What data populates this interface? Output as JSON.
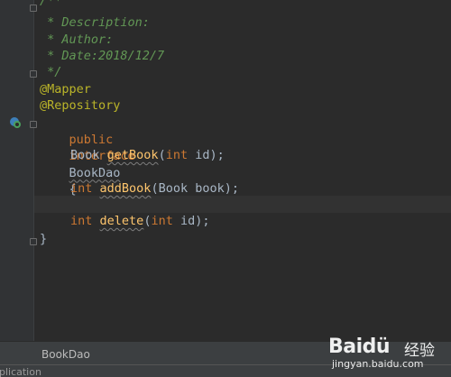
{
  "editor": {
    "lines": {
      "comment_open": "/**",
      "description": " * Description:",
      "author": " * Author:",
      "date": " * Date:2018/12/7",
      "comment_close": " */",
      "mapper": "@Mapper",
      "repository": "@Repository",
      "kw_public": "public",
      "kw_interface": "interface",
      "interface_name": "BookDao",
      "brace_open": "{",
      "type_book": "Book",
      "method_getbook": "getBook",
      "getbook_params_pre": "(",
      "kw_int": "int",
      "param_id": " id);",
      "kw_int2": "int",
      "method_addbook": "addBook",
      "addbook_params": "(Book book);",
      "kw_int3": "int",
      "method_delete": "delete",
      "delete_params_pre": "(",
      "kw_int4": "int",
      "param_id2": " id);",
      "brace_close": "}"
    }
  },
  "tabs": {
    "active": "BookDao"
  },
  "status": {
    "text": "pplication"
  },
  "watermark": {
    "logo": "Baidü",
    "cn": "经验",
    "url": "jingyan.baidu.com"
  },
  "colors": {
    "background": "#2b2b2b",
    "keyword": "#cc7832",
    "annotation": "#bbb529",
    "comment": "#629755",
    "text": "#a9b7c6"
  }
}
